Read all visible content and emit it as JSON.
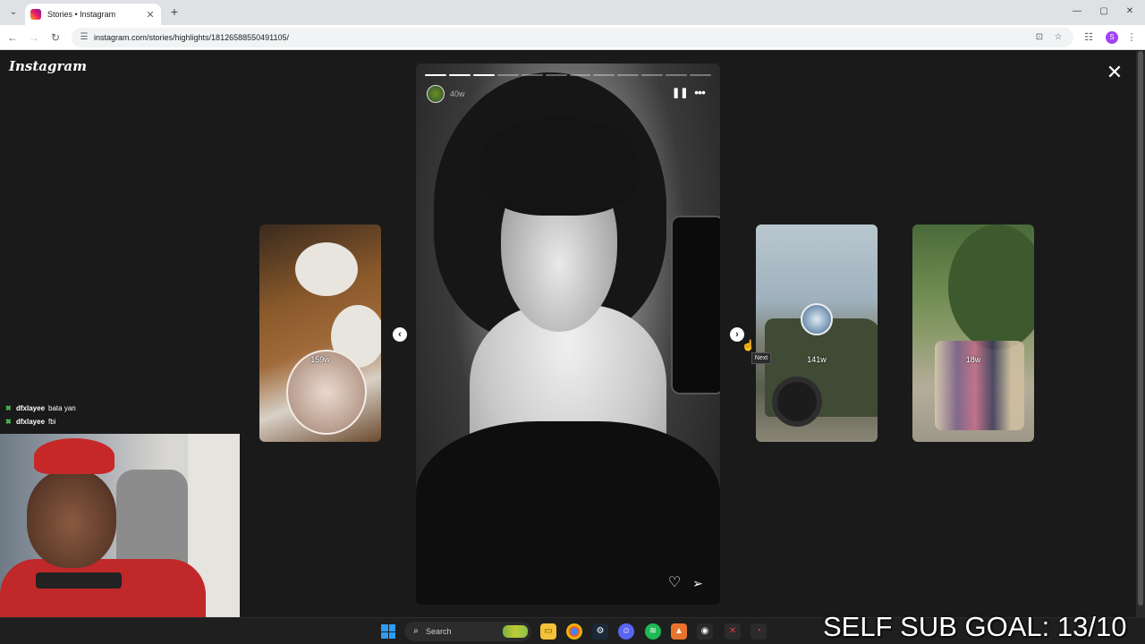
{
  "browser": {
    "tab": {
      "title": "Stories • Instagram",
      "close": "✕"
    },
    "new_tab": "+",
    "window_controls": {
      "minimize": "—",
      "maximize": "▢",
      "close": "✕"
    },
    "nav": {
      "back": "←",
      "forward": "→",
      "reload": "↻"
    },
    "url": "instagram.com/stories/highlights/18126588550491105/",
    "profile_initial": "S"
  },
  "viewer": {
    "logo": "Instagram",
    "close_glyph": "✕",
    "story": {
      "segments_total": 12,
      "segments_done": 3,
      "time": "40w",
      "pause_glyph": "❚❚",
      "more_glyph": "•••",
      "like_glyph": "♡",
      "share_glyph": "➢"
    },
    "previews": [
      {
        "label": "159w"
      },
      {
        "label": "141w"
      },
      {
        "label": "18w"
      }
    ],
    "prev_arrow": "‹",
    "next_arrow": "›",
    "tooltip": "Next"
  },
  "stream": {
    "chat": [
      {
        "user": "dfxlayee",
        "message": "bata yan"
      },
      {
        "user": "dfxlayee",
        "message": "fbi"
      }
    ],
    "goal_text": "SELF SUB GOAL: 13/10"
  },
  "taskbar": {
    "search_label": "Search"
  }
}
